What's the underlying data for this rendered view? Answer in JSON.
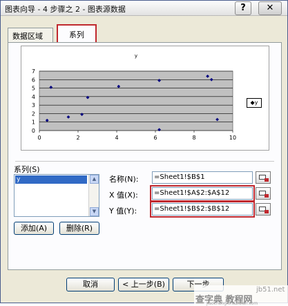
{
  "window": {
    "title": "图表向导 - 4 步骤之 2 - 图表源数据",
    "help_label": "?",
    "close_label": "✕"
  },
  "tabs": [
    {
      "label": "数据区域"
    },
    {
      "label": "系列"
    }
  ],
  "chart_data": {
    "type": "scatter",
    "title": "y",
    "xlim": [
      0,
      10
    ],
    "ylim": [
      0,
      7
    ],
    "x_ticks": [
      "0",
      "2",
      "4",
      "6",
      "8",
      "10"
    ],
    "y_ticks": [
      "0",
      "1",
      "2",
      "3",
      "4",
      "5",
      "6",
      "7"
    ],
    "grid": true,
    "legend_position": "right",
    "series": [
      {
        "name": "y",
        "x": [
          0.4,
          0.6,
          1.5,
          2.2,
          2.5,
          4.1,
          6.2,
          6.2,
          8.7,
          8.9,
          9.2
        ],
        "y": [
          1.2,
          5.1,
          1.6,
          1.9,
          3.9,
          5.2,
          0.1,
          5.9,
          6.4,
          6.0,
          1.3
        ]
      }
    ]
  },
  "series_panel": {
    "label": "系列(S)",
    "items": [
      "y"
    ],
    "add_label": "添加(A)",
    "delete_label": "删除(R)"
  },
  "fields": {
    "name": {
      "label": "名称(N):",
      "value": "=Sheet1!$B$1"
    },
    "x": {
      "label": "X 值(X):",
      "value": "=Sheet1!$A$2:$A$12"
    },
    "y": {
      "label": "Y 值(Y):",
      "value": "=Sheet1!$B$2:$B$12"
    }
  },
  "footer": {
    "cancel_label": "取消",
    "back_label": "< 上一步(B)",
    "next_label": "下一步"
  },
  "watermark": {
    "site": "jb51.net",
    "name": "查字典 教程网",
    "url": "jiaocheng.chazidian.com"
  },
  "colors": {
    "plot_area": "#c0c0c0",
    "marker": "#000080",
    "highlight": "#c0282e",
    "selection": "#316ac5"
  }
}
